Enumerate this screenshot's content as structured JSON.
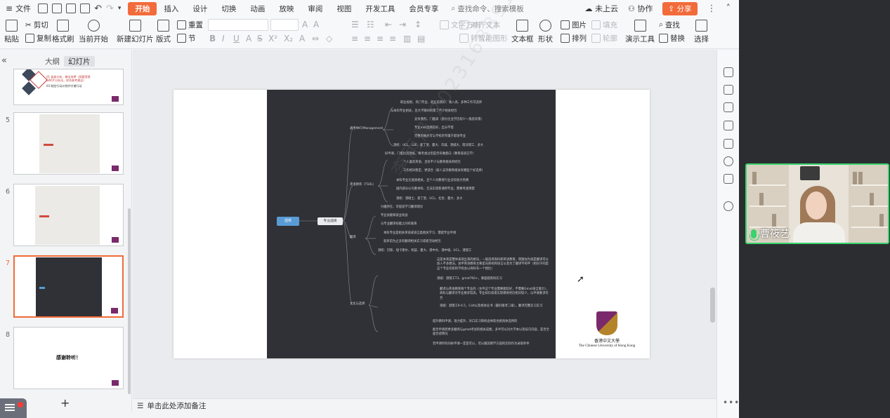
{
  "menu": {
    "file": "文件",
    "tabs": [
      "开始",
      "插入",
      "设计",
      "切换",
      "动画",
      "放映",
      "审阅",
      "视图",
      "开发工具",
      "会员专享"
    ],
    "active_tab": 0,
    "search_placeholder": "查找命令、搜索模板",
    "cloud": "未上云",
    "collab": "协作",
    "share": "分享"
  },
  "ribbon": {
    "paste": "粘贴",
    "cut": "剪切",
    "copy": "复制",
    "format_painter": "格式刷",
    "play_from_current": "当前开始",
    "new_slide": "新建幻灯片",
    "layout": "版式",
    "reset": "重置",
    "section": "节",
    "text_direction": "文字方向",
    "align_text": "对齐文本",
    "convert_smartart": "转智能图形",
    "textbox": "文本框",
    "shape": "形状",
    "picture": "图片",
    "arrange": "排列",
    "fill": "填充",
    "outline": "轮廓",
    "present_tools": "演示工具",
    "find": "查找",
    "replace": "替换",
    "select": "选择"
  },
  "left_panel": {
    "tab_outline": "大纲",
    "tab_slides": "幻灯片",
    "slide_numbers": [
      "5",
      "6",
      "7",
      "8"
    ],
    "active_slide": "7",
    "slide8_text": "感谢聆听！",
    "slide4_lines": [
      "01 具体分析，做出选择（拆题型细",
      "SWOT分析法，综合参考建议）",
      "03 制定行动计划并付诸行动"
    ]
  },
  "mindmap": {
    "root": "选校",
    "main": "专业选择",
    "branches": [
      {
        "label": "通用MKT/Management"
      },
      {
        "label": "英语教育（TSOL）"
      },
      {
        "label": "翻译"
      },
      {
        "label": "文化与选择"
      }
    ],
    "leaves": [
      "职业规划、热门专业、就业前景好、收入高、多种工作可选择",
      "与本科专业相关，且大学期间积累了不少相关经历",
      "竞争激烈，门槛高（部分企业学历较少一般差背景）",
      "专业mkt选择较好，出分不错",
      "完整的展开可与学校的专属于职场专业",
      "港校：UCL、LSE、爱丁堡、曼大、华威、港城大、南洋理工、多大",
      "好申请、门槛比其他低，要考虑过后是否有做意向（教育或语言学）",
      "个人喜欢英语、且有不少与教育相关的经历",
      "工作相对稳定，更适合（家人支持教育相关有哪些个好选择）",
      "本科专业无直接相关，且个人对教育行业没有很大热情",
      "国内部分公司重本科，无法实现新通用专业，需要考虑清楚",
      "港校：港硕士、爱丁堡、UCL、杜伦、曼大、多大",
      "兴趣所在、可提前学习翻译理论",
      "专业技能和就业机会",
      "与专业翻译技能之间有联系",
      "本科专业是相关英语或语言类相关学习、需提专业申请",
      "就目前为止没有翻译相关实习或者活动经历",
      "港校：巴斯、纽卡斯尔、利兹、曼大、港中文、港中城、UCL、港理工",
      "这是本来是整体表现出来的想法，一般选择商科和英语教育，而跟加为就是翻译可以加入不多想法。加申英语教育主要是向商校和语言以及为了翻译不和平（相对于的是这个专业有职的学校会以商科有一个相比）",
      "港城：港理工T3、gmat760+，要超越商科实习",
      "翻译与英语教育两个专业的（主申这个专业需要能较好，不需要Gmat语言能力），商科与翻译对专业要求较高，专业知识或者实际教育经历相对较少，与申请要求符合",
      "港城：港理工6-6.5，Celt以及相关证书（最好能考二级），翻译完整实习实习",
      "提升教科申请，语力提升，对口实习和机会体现也想具体选择的",
      "能否申请到更多翻译与gmat考试的相关成绩，多半可以对大学本以及技巧内容，是否全面合适情况",
      "若申请时有同样申请一定是可以，可以跟其教学方面的实际作为录取条件"
    ]
  },
  "slide_logo": {
    "cn": "香港中文大學",
    "en": "The Chinese University of Hong Kong"
  },
  "watermark": "李雨晨 2023168891",
  "notes_placeholder": "单击此处添加备注",
  "video": {
    "name": "曹筱艺"
  }
}
